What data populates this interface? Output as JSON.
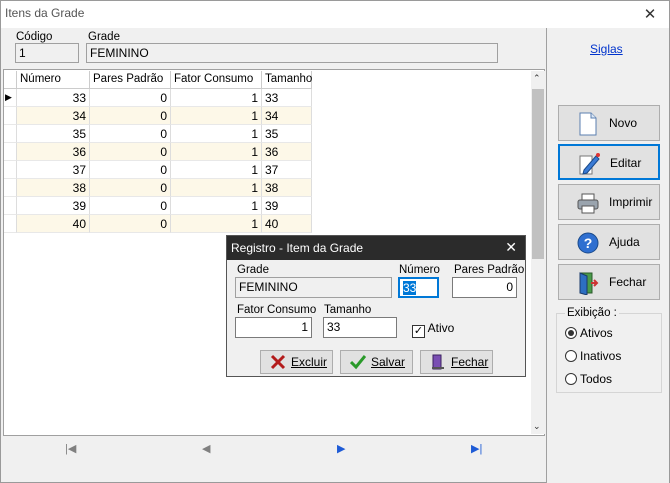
{
  "window": {
    "title": "Itens da Grade",
    "close": "✕"
  },
  "header": {
    "codigo_label": "Código",
    "codigo_value": "1",
    "grade_label": "Grade",
    "grade_value": "FEMININO",
    "siglas_link": "Siglas"
  },
  "grid": {
    "columns": [
      "Número",
      "Pares Padrão",
      "Fator Consumo",
      "Tamanho"
    ],
    "rows": [
      [
        "33",
        "0",
        "1",
        "33"
      ],
      [
        "34",
        "0",
        "1",
        "34"
      ],
      [
        "35",
        "0",
        "1",
        "35"
      ],
      [
        "36",
        "0",
        "1",
        "36"
      ],
      [
        "37",
        "0",
        "1",
        "37"
      ],
      [
        "38",
        "0",
        "1",
        "38"
      ],
      [
        "39",
        "0",
        "1",
        "39"
      ],
      [
        "40",
        "0",
        "1",
        "40"
      ]
    ],
    "current_row_marker": "▶"
  },
  "nav": {
    "first": "|◀",
    "prev": "◀",
    "next": "▶",
    "last": "▶|"
  },
  "buttons": {
    "novo": {
      "label": "Novo",
      "icon": "new-document-icon"
    },
    "editar": {
      "label": "Editar",
      "icon": "edit-pen-icon"
    },
    "imprimir": {
      "label": "Imprimir",
      "icon": "printer-icon"
    },
    "ajuda": {
      "label": "Ajuda",
      "icon": "help-icon"
    },
    "fechar": {
      "label": "Fechar",
      "icon": "exit-door-icon"
    }
  },
  "exibicao": {
    "legend": "Exibição :",
    "options": [
      "Ativos",
      "Inativos",
      "Todos"
    ],
    "selected": "Ativos"
  },
  "dialog": {
    "title": "Registro - Item da Grade",
    "close": "✕",
    "grade_label": "Grade",
    "grade_value": "FEMININO",
    "numero_label": "Número",
    "numero_value": "33",
    "pares_label": "Pares Padrão",
    "pares_value": "0",
    "fator_label": "Fator Consumo",
    "fator_value": "1",
    "tamanho_label": "Tamanho",
    "tamanho_value": "33",
    "ativo_label": "Ativo",
    "ativo_checked": true,
    "excluir_label": "Excluir",
    "salvar_label": "Salvar",
    "fechar_label": "Fechar"
  },
  "colors": {
    "accent": "#0078d7",
    "row_alt": "#fdf8e8",
    "link": "#0033cc",
    "nav_active": "#1e5bd6"
  }
}
